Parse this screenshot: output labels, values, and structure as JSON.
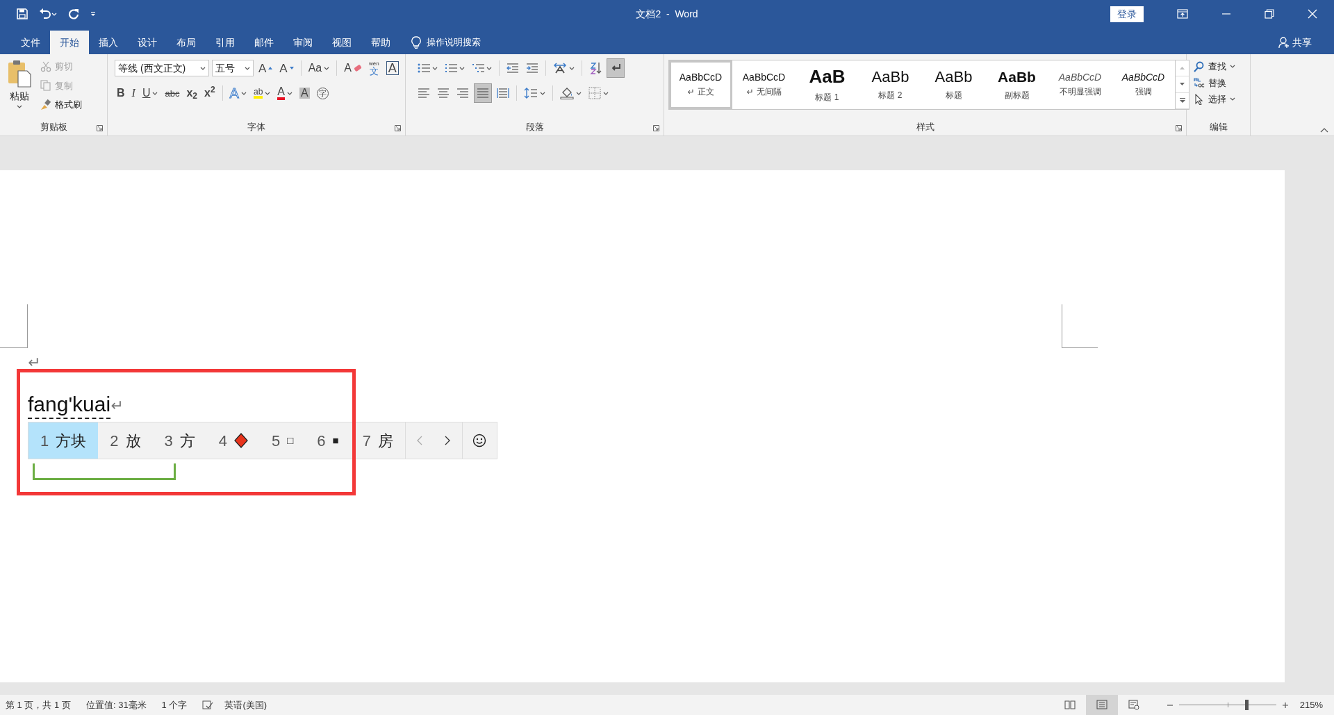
{
  "window": {
    "title": "文档2  -  Word",
    "login_button": "登录"
  },
  "ribbon_tabs": [
    {
      "label": "文件",
      "selected": false
    },
    {
      "label": "开始",
      "selected": true
    },
    {
      "label": "插入",
      "selected": false
    },
    {
      "label": "设计",
      "selected": false
    },
    {
      "label": "布局",
      "selected": false
    },
    {
      "label": "引用",
      "selected": false
    },
    {
      "label": "邮件",
      "selected": false
    },
    {
      "label": "审阅",
      "selected": false
    },
    {
      "label": "视图",
      "selected": false
    },
    {
      "label": "帮助",
      "selected": false
    }
  ],
  "tell_me": "操作说明搜索",
  "share": "共享",
  "clipboard": {
    "label": "剪贴板",
    "paste": "粘贴",
    "items": [
      {
        "label": "剪切",
        "kind": "cut",
        "disabled": true
      },
      {
        "label": "复制",
        "kind": "copy",
        "disabled": true
      },
      {
        "label": "格式刷",
        "kind": "painter",
        "disabled": false
      }
    ]
  },
  "font": {
    "label": "字体",
    "font_name": "等线 (西文正文)",
    "font_size": "五号",
    "row1": [
      {
        "glyph": "A",
        "kind": "grow-font"
      },
      {
        "glyph": "A",
        "kind": "shrink-font"
      },
      {
        "glyph": "Aa",
        "kind": "change-case"
      },
      {
        "glyph": "A",
        "kind": "clear-format"
      },
      {
        "glyph": "文",
        "ruby": "wén",
        "kind": "phonetic-guide"
      },
      {
        "glyph": "A",
        "kind": "char-border"
      }
    ],
    "row2": [
      {
        "glyph": "B",
        "kind": "bold"
      },
      {
        "glyph": "I",
        "kind": "italic"
      },
      {
        "glyph": "U",
        "kind": "underline"
      },
      {
        "glyph": "abc",
        "kind": "strikethrough"
      },
      {
        "glyph": "x$_{2}$",
        "kind": "subscript"
      },
      {
        "glyph": "x$^{2}$",
        "kind": "superscript"
      },
      {
        "glyph": "A",
        "kind": "text-effects"
      },
      {
        "glyph": "ab",
        "kind": "highlight"
      },
      {
        "glyph": "A",
        "kind": "font-color"
      },
      {
        "glyph": "A",
        "kind": "char-shading"
      },
      {
        "glyph": "字",
        "kind": "enclose-char"
      }
    ]
  },
  "paragraph": {
    "label": "段落",
    "show_marks": {
      "on": true
    },
    "align_buttons": [
      {
        "kind": "left",
        "selected": false
      },
      {
        "kind": "center",
        "selected": false
      },
      {
        "kind": "right",
        "selected": false
      },
      {
        "kind": "justify",
        "selected": true
      },
      {
        "kind": "distributed",
        "selected": false
      }
    ]
  },
  "styles": {
    "label": "样式",
    "items": [
      {
        "preview": "AaBbCcD",
        "name": "正文",
        "para_mark": "↵",
        "kind": "normal",
        "selected": true
      },
      {
        "preview": "AaBbCcD",
        "name": "无间隔",
        "para_mark": "↵",
        "kind": "normal",
        "selected": false
      },
      {
        "preview": "AaB",
        "name": "标题 1",
        "kind": "heading1",
        "selected": false
      },
      {
        "preview": "AaBb",
        "name": "标题 2",
        "kind": "heading2",
        "selected": false
      },
      {
        "preview": "AaBb",
        "name": "标题",
        "kind": "title",
        "selected": false
      },
      {
        "preview": "AaBb",
        "name": "副标题",
        "kind": "subtitle",
        "selected": false
      },
      {
        "preview": "AaBbCcD",
        "name": "不明显强调",
        "kind": "subtle",
        "selected": false
      },
      {
        "preview": "AaBbCcD",
        "name": "强调",
        "kind": "emphasis",
        "selected": false
      }
    ]
  },
  "editing": {
    "label": "编辑",
    "items": [
      {
        "label": "查找",
        "kind": "find"
      },
      {
        "label": "替换",
        "kind": "replace"
      },
      {
        "label": "选择",
        "kind": "select"
      }
    ]
  },
  "document": {
    "empty_line_mark": "↵",
    "composition": "fang'kuai",
    "line_end_mark": "↵"
  },
  "ime": {
    "candidates": [
      {
        "index": "1",
        "text": "方块",
        "kind": "text",
        "selected": true
      },
      {
        "index": "2",
        "text": "放",
        "kind": "text",
        "selected": false
      },
      {
        "index": "3",
        "text": "方",
        "kind": "text",
        "selected": false
      },
      {
        "index": "4",
        "kind": "diamond",
        "selected": false
      },
      {
        "index": "5",
        "text": "□",
        "kind": "text",
        "selected": false
      },
      {
        "index": "6",
        "text": "■",
        "kind": "text",
        "selected": false
      },
      {
        "index": "7",
        "text": "房",
        "kind": "text",
        "selected": false
      }
    ]
  },
  "status_bar": {
    "page": "第 1 页，共 1 页",
    "position": "位置值: 31毫米",
    "words": "1 个字",
    "language": "英语(美国)",
    "views": [
      {
        "kind": "read",
        "selected": false
      },
      {
        "kind": "print",
        "selected": true
      },
      {
        "kind": "web",
        "selected": false
      }
    ],
    "zoom_slider": {
      "level": 0.68
    },
    "zoom": "215%"
  }
}
